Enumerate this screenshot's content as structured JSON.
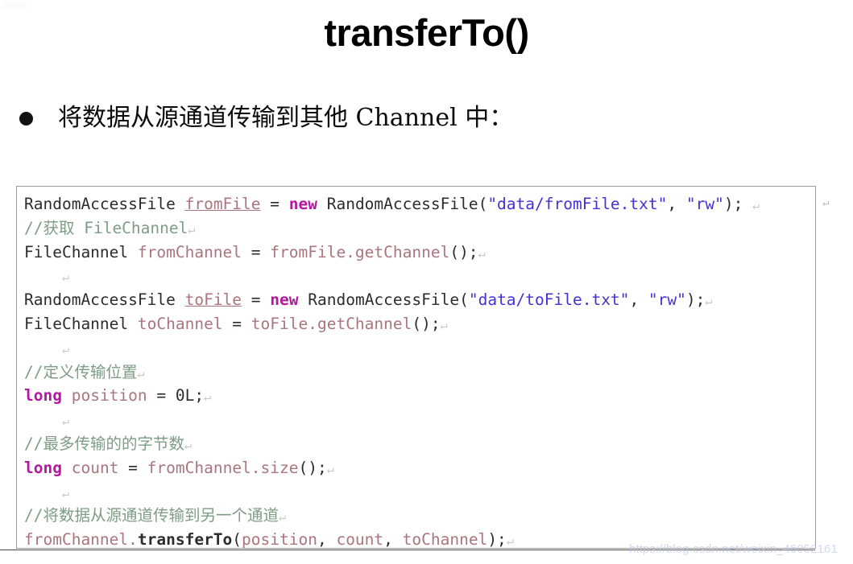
{
  "slide": {
    "title": "transferTo()",
    "bullet": {
      "marker": "bullet-dot",
      "text": "将数据从源通道传输到其他 Channel 中："
    }
  },
  "code_block": {
    "language": "java",
    "lines": [
      {
        "id": "line-1",
        "plain": "RandomAccessFile fromFile = new RandomAccessFile(\"data/fromFile.txt\", \"rw\");",
        "tokens": [
          {
            "t": "RandomAccessFile",
            "k": "type"
          },
          {
            "t": " ",
            "k": "plain"
          },
          {
            "t": "fromFile",
            "k": "decl"
          },
          {
            "t": " = ",
            "k": "plain"
          },
          {
            "t": "new",
            "k": "kw"
          },
          {
            "t": " RandomAccessFile(",
            "k": "plain"
          },
          {
            "t": "\"data/fromFile.txt\"",
            "k": "str"
          },
          {
            "t": ", ",
            "k": "plain"
          },
          {
            "t": "\"rw\"",
            "k": "str"
          },
          {
            "t": "); ",
            "k": "plain"
          },
          {
            "t": "↵",
            "k": "pilcrow"
          }
        ]
      },
      {
        "id": "line-2",
        "plain": "//获取 FileChannel",
        "tokens": [
          {
            "t": "//获取 FileChannel",
            "k": "cmt"
          },
          {
            "t": "↵",
            "k": "pilcrow"
          }
        ]
      },
      {
        "id": "line-3",
        "plain": "FileChannel fromChannel = fromFile.getChannel();",
        "tokens": [
          {
            "t": "FileChannel",
            "k": "type"
          },
          {
            "t": " ",
            "k": "plain"
          },
          {
            "t": "fromChannel",
            "k": "var"
          },
          {
            "t": " = ",
            "k": "plain"
          },
          {
            "t": "fromFile.getChannel",
            "k": "var"
          },
          {
            "t": "();",
            "k": "plain"
          },
          {
            "t": "↵",
            "k": "pilcrow"
          }
        ]
      },
      {
        "id": "line-4",
        "plain": "",
        "tokens": [
          {
            "t": "    ",
            "k": "plain"
          },
          {
            "t": "↵",
            "k": "pilcrow"
          }
        ]
      },
      {
        "id": "line-5",
        "plain": "RandomAccessFile toFile = new RandomAccessFile(\"data/toFile.txt\", \"rw\");",
        "tokens": [
          {
            "t": "RandomAccessFile",
            "k": "type"
          },
          {
            "t": " ",
            "k": "plain"
          },
          {
            "t": "toFile",
            "k": "decl"
          },
          {
            "t": " = ",
            "k": "plain"
          },
          {
            "t": "new",
            "k": "kw"
          },
          {
            "t": " RandomAccessFile(",
            "k": "plain"
          },
          {
            "t": "\"data/toFile.txt\"",
            "k": "str"
          },
          {
            "t": ", ",
            "k": "plain"
          },
          {
            "t": "\"rw\"",
            "k": "str"
          },
          {
            "t": ");",
            "k": "plain"
          },
          {
            "t": "↵",
            "k": "pilcrow"
          }
        ]
      },
      {
        "id": "line-6",
        "plain": "FileChannel toChannel = toFile.getChannel();",
        "tokens": [
          {
            "t": "FileChannel",
            "k": "type"
          },
          {
            "t": " ",
            "k": "plain"
          },
          {
            "t": "toChannel",
            "k": "var"
          },
          {
            "t": " = ",
            "k": "plain"
          },
          {
            "t": "toFile.getChannel",
            "k": "var"
          },
          {
            "t": "();",
            "k": "plain"
          },
          {
            "t": "↵",
            "k": "pilcrow"
          }
        ]
      },
      {
        "id": "line-7",
        "plain": "",
        "tokens": [
          {
            "t": "    ",
            "k": "plain"
          },
          {
            "t": "↵",
            "k": "pilcrow"
          }
        ]
      },
      {
        "id": "line-8",
        "plain": "//定义传输位置",
        "tokens": [
          {
            "t": "//定义传输位置",
            "k": "cmt"
          },
          {
            "t": "↵",
            "k": "pilcrow"
          }
        ]
      },
      {
        "id": "line-9",
        "plain": "long position = 0L;",
        "tokens": [
          {
            "t": "long",
            "k": "kw"
          },
          {
            "t": " ",
            "k": "plain"
          },
          {
            "t": "position",
            "k": "var"
          },
          {
            "t": " = ",
            "k": "plain"
          },
          {
            "t": "0L;",
            "k": "plain"
          },
          {
            "t": "↵",
            "k": "pilcrow"
          }
        ]
      },
      {
        "id": "line-10",
        "plain": "",
        "tokens": [
          {
            "t": "    ",
            "k": "plain"
          },
          {
            "t": "↵",
            "k": "pilcrow"
          }
        ]
      },
      {
        "id": "line-11",
        "plain": "//最多传输的的字节数",
        "tokens": [
          {
            "t": "//最多传输的的字节数",
            "k": "cmt"
          },
          {
            "t": "↵",
            "k": "pilcrow"
          }
        ]
      },
      {
        "id": "line-12",
        "plain": "long count = fromChannel.size();",
        "tokens": [
          {
            "t": "long",
            "k": "kw"
          },
          {
            "t": " ",
            "k": "plain"
          },
          {
            "t": "count",
            "k": "var"
          },
          {
            "t": " = ",
            "k": "plain"
          },
          {
            "t": "fromChannel.size",
            "k": "var"
          },
          {
            "t": "();",
            "k": "plain"
          },
          {
            "t": "↵",
            "k": "pilcrow"
          }
        ]
      },
      {
        "id": "line-13",
        "plain": "",
        "tokens": [
          {
            "t": "    ",
            "k": "plain"
          },
          {
            "t": "↵",
            "k": "pilcrow"
          }
        ]
      },
      {
        "id": "line-14",
        "plain": "//将数据从源通道传输到另一个通道",
        "tokens": [
          {
            "t": "//将数据从源通道传输到另一个通道",
            "k": "cmt"
          },
          {
            "t": "↵",
            "k": "pilcrow"
          }
        ]
      },
      {
        "id": "line-15",
        "plain": "fromChannel.transferTo(position, count, toChannel);",
        "tokens": [
          {
            "t": "fromChannel.",
            "k": "var"
          },
          {
            "t": "transferTo",
            "k": "bold"
          },
          {
            "t": "(",
            "k": "plain"
          },
          {
            "t": "position",
            "k": "var"
          },
          {
            "t": ", ",
            "k": "plain"
          },
          {
            "t": "count",
            "k": "var"
          },
          {
            "t": ", ",
            "k": "plain"
          },
          {
            "t": "toChannel",
            "k": "var"
          },
          {
            "t": ");",
            "k": "plain"
          },
          {
            "t": "↵",
            "k": "pilcrow"
          }
        ]
      }
    ]
  },
  "watermark": {
    "text": "https://blog.csdn.net/weixin_46052161"
  },
  "colors": {
    "page_background": "#ffffff",
    "title": "#000000",
    "code_border": "#9a9a9a",
    "keyword": "#b5179e",
    "string": "#4332d4",
    "comment": "#7e9c86",
    "variable": "#aa757c",
    "type": "#2c2c2c",
    "watermark": "#b9c3e6"
  }
}
